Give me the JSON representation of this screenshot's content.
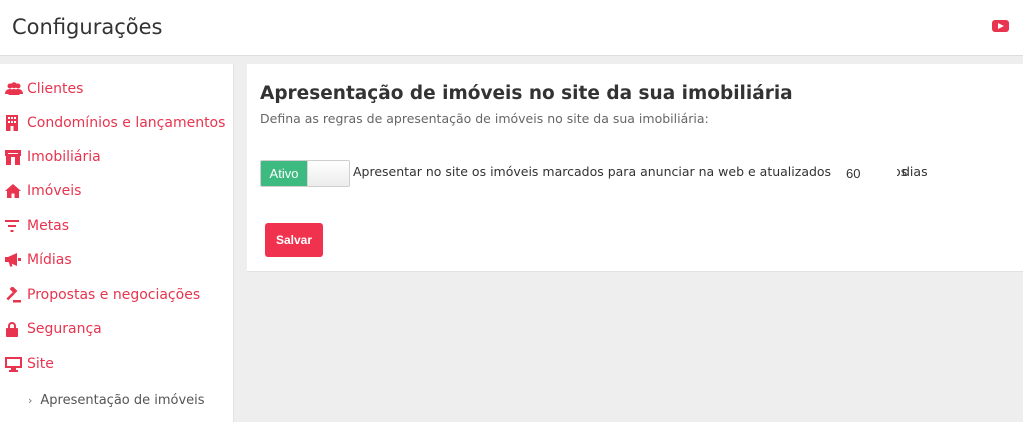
{
  "header": {
    "title": "Configurações",
    "video_icon": "youtube-icon",
    "accent_color": "#e8344e"
  },
  "sidebar": {
    "items": [
      {
        "label": "Clientes",
        "icon": "users-icon"
      },
      {
        "label": "Condomínios e lançamentos",
        "icon": "building-icon"
      },
      {
        "label": "Imobiliária",
        "icon": "storefront-icon"
      },
      {
        "label": "Imóveis",
        "icon": "home-icon"
      },
      {
        "label": "Metas",
        "icon": "filter-icon"
      },
      {
        "label": "Mídias",
        "icon": "megaphone-icon"
      },
      {
        "label": "Propostas e negociações",
        "icon": "gavel-icon"
      },
      {
        "label": "Segurança",
        "icon": "lock-icon"
      },
      {
        "label": "Site",
        "icon": "monitor-icon"
      }
    ],
    "sub_item": {
      "label": "Apresentação de imóveis",
      "icon": "chevron-right-icon"
    }
  },
  "main": {
    "title": "Apresentação de imóveis no site da sua imobiliária",
    "subtitle": "Defina as regras de apresentação de imóveis no site da sua imobiliária:",
    "toggle": {
      "label": "Ativo",
      "state": "on",
      "color": "#3dba80"
    },
    "rule_text": "Apresentar no site os imóveis marcados para anunciar na web e atualizados nos últimos",
    "days_value": "60",
    "days_label": "dias",
    "save_label": "Salvar",
    "save_color": "#f0324f"
  }
}
